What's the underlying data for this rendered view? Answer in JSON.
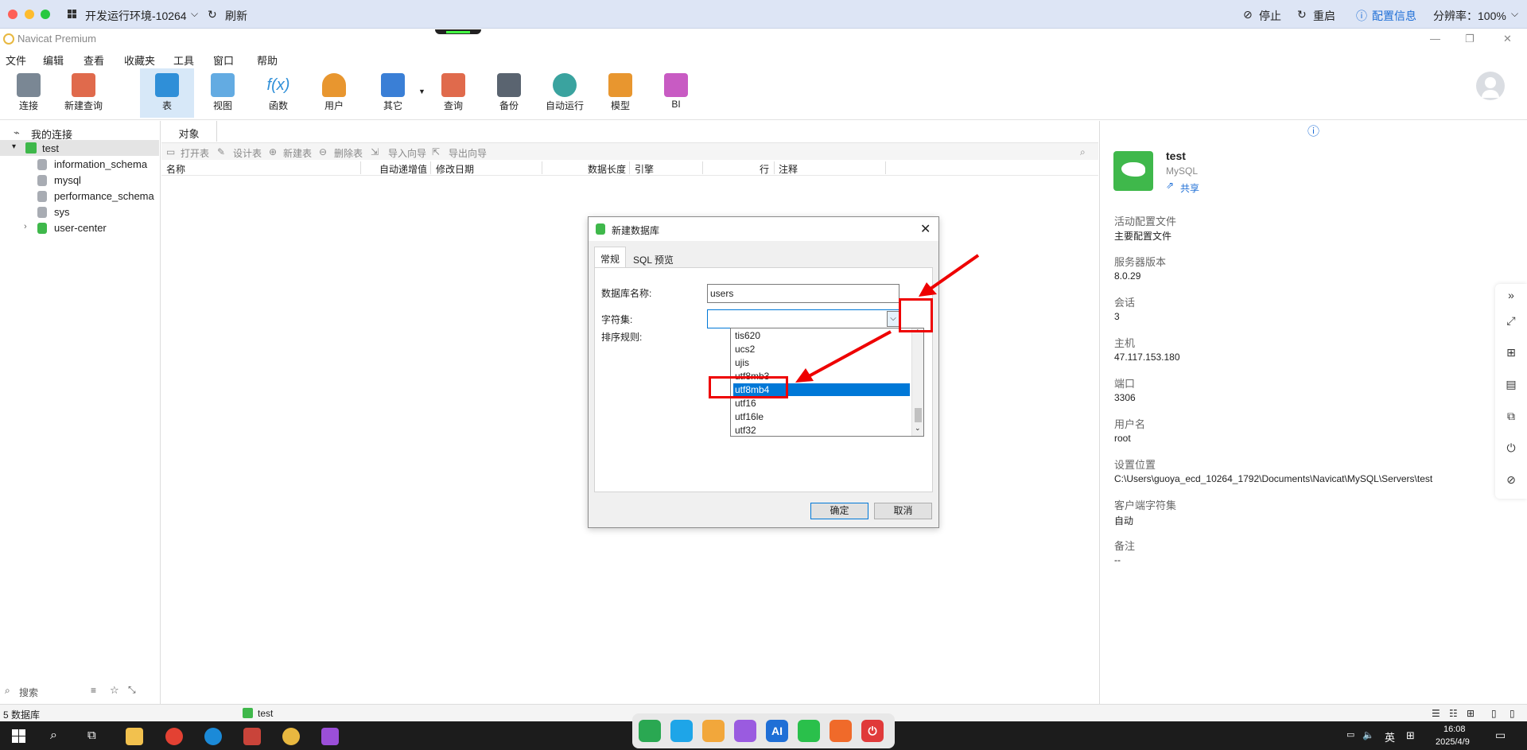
{
  "remote_bar": {
    "env_label": "开发运行环境-10264",
    "refresh": "刷新",
    "stop": "停止",
    "restart": "重启",
    "config_info": "配置信息",
    "resolution": "分辨率：100%"
  },
  "app": {
    "title": "Navicat Premium"
  },
  "menu": [
    "文件",
    "编辑",
    "查看",
    "收藏夹",
    "工具",
    "窗口",
    "帮助"
  ],
  "toolbar": [
    {
      "label": "连接",
      "color": "#7a8794"
    },
    {
      "label": "新建查询",
      "color": "#e06a4c"
    },
    {
      "label": "表",
      "color": "#2f8fd8"
    },
    {
      "label": "视图",
      "color": "#2f8fd8"
    },
    {
      "label": "函数",
      "color": "#2f8fd8"
    },
    {
      "label": "用户",
      "color": "#e8962f"
    },
    {
      "label": "其它",
      "color": "#3a7fd6"
    },
    {
      "label": "查询",
      "color": "#e06a4c"
    },
    {
      "label": "备份",
      "color": "#5a6470"
    },
    {
      "label": "自动运行",
      "color": "#3aa39f"
    },
    {
      "label": "模型",
      "color": "#e8962f"
    },
    {
      "label": "BI",
      "color": "#c85bc3"
    }
  ],
  "tree": {
    "root": "我的连接",
    "connection": "test",
    "databases": [
      "information_schema",
      "mysql",
      "performance_schema",
      "sys",
      "user-center"
    ],
    "search_placeholder": "搜索"
  },
  "center": {
    "tab": "对象",
    "actions": [
      "打开表",
      "设计表",
      "新建表",
      "删除表",
      "导入向导",
      "导出向导"
    ],
    "columns": [
      "名称",
      "自动递增值",
      "修改日期",
      "数据长度",
      "引擎",
      "行",
      "注释"
    ]
  },
  "dialog": {
    "title": "新建数据库",
    "tabs": [
      "常规",
      "SQL 预览"
    ],
    "name_label": "数据库名称:",
    "name_value": "users",
    "charset_label": "字符集:",
    "collation_label": "排序规则:",
    "charset_options": [
      "tis620",
      "ucs2",
      "ujis",
      "utf8mb3",
      "utf8mb4",
      "utf16",
      "utf16le",
      "utf32"
    ],
    "selected_option": "utf8mb4",
    "ok": "确定",
    "cancel": "取消"
  },
  "info_panel": {
    "name": "test",
    "type": "MySQL",
    "share": "共享",
    "fields": [
      {
        "label": "活动配置文件",
        "value": "主要配置文件"
      },
      {
        "label": "服务器版本",
        "value": "8.0.29"
      },
      {
        "label": "会话",
        "value": "3"
      },
      {
        "label": "主机",
        "value": "47.117.153.180"
      },
      {
        "label": "端口",
        "value": "3306"
      },
      {
        "label": "用户名",
        "value": "root"
      },
      {
        "label": "设置位置",
        "value": "C:\\Users\\guoya_ecd_10264_1792\\Documents\\Navicat\\MySQL\\Servers\\test"
      },
      {
        "label": "客户端字符集",
        "value": "自动"
      },
      {
        "label": "备注",
        "value": "--"
      }
    ]
  },
  "status": {
    "db_count": "5 数据库",
    "connection": "test"
  },
  "taskbar": {
    "ime": "英",
    "time": "16:08",
    "date": "2025/4/9"
  }
}
